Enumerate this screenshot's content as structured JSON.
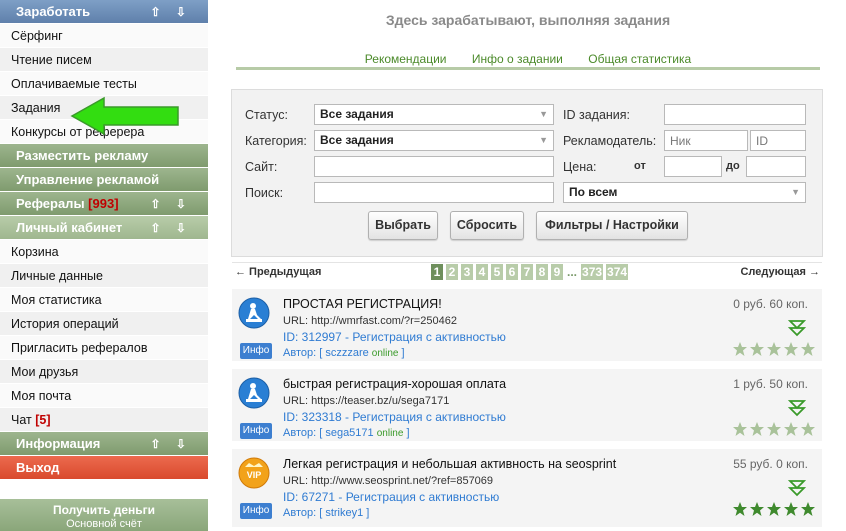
{
  "sidebar": {
    "earn": {
      "title": "Заработать",
      "arrows": "⇧ ⇩"
    },
    "earn_items": [
      "Сёрфинг",
      "Чтение писем",
      "Оплачиваемые тесты",
      "Задания",
      "Конкурсы от реферера"
    ],
    "place_ad": "Разместить рекламу",
    "manage_ad": "Управление рекламой",
    "referrals": {
      "title": "Рефералы",
      "count": "[993]",
      "arrows": "⇧ ⇩"
    },
    "cabinet": {
      "title": "Личный кабинет",
      "arrows": "⇧ ⇩"
    },
    "cabinet_items": [
      "Корзина",
      "Личные данные",
      "Моя статистика",
      "История операций",
      "Пригласить рефералов",
      "Мои друзья",
      "Моя почта"
    ],
    "chat": {
      "label": "Чат",
      "count": "[5]"
    },
    "information": {
      "title": "Информация",
      "arrows": "⇧ ⇩"
    },
    "logout": "Выход",
    "get_money": {
      "title": "Получить деньги",
      "subtitle": "Основной счёт"
    }
  },
  "main": {
    "heading": "Здесь зарабатывают, выполняя задания",
    "tabs": [
      "Рекомендации",
      "Инфо о задании",
      "Общая статистика"
    ]
  },
  "filter": {
    "status_label": "Статус:",
    "status_value": "Все задания",
    "category_label": "Категория:",
    "category_value": "Все задания",
    "site_label": "Сайт:",
    "search_label": "Поиск:",
    "task_id_label": "ID задания:",
    "advertiser_label": "Рекламодатель:",
    "nick_placeholder": "Ник",
    "id_placeholder": "ID",
    "price_label": "Цена:",
    "from_label": "от",
    "to_label": "до",
    "search_scope": "По всем",
    "btn_select": "Выбрать",
    "btn_reset": "Сбросить",
    "btn_filters": "Фильтры / Настройки"
  },
  "pager": {
    "prev": "← Предыдущая",
    "next": "Следующая →",
    "pages": [
      "1",
      "2",
      "3",
      "4",
      "5",
      "6",
      "7",
      "8",
      "9",
      "...",
      "373",
      "374"
    ],
    "current": "1"
  },
  "tasks": [
    {
      "title": "ПРОСТАЯ РЕГИСТРАЦИЯ!",
      "url": "URL: http://wmrfast.com/?r=250462",
      "id": "ID: 312997 - Регистрация с активностью",
      "author_prefix": "Автор: [ ",
      "author_nick": "sczzzare",
      "author_status": "online",
      "author_suffix": " ]",
      "price": "0 руб. 60 коп.",
      "info": "Инфо",
      "icon": "worker-icon",
      "rating": 0
    },
    {
      "title": "быстрая регистрация-хорошая оплата",
      "url": "URL: https://teaser.bz/u/sega7171",
      "id": "ID: 323318 - Регистрация с активностью",
      "author_prefix": "Автор: [ ",
      "author_nick": "sega5171",
      "author_status": "online",
      "author_suffix": " ]",
      "price": "1 руб. 50 коп.",
      "info": "Инфо",
      "icon": "worker-icon",
      "rating": 0
    },
    {
      "title": "Легкая регистрация и небольшая активность на seosprint",
      "url": "URL: http://www.seosprint.net/?ref=857069",
      "id": "ID: 67271 - Регистрация с активностью",
      "author_prefix": "Автор: [ ",
      "author_nick": "strikey1",
      "author_status": "",
      "author_suffix": " ]",
      "price": "55 руб. 0 коп.",
      "info": "Инфо",
      "icon": "vip-icon",
      "icon_text": "VIP",
      "rating": 5
    }
  ],
  "colors": {
    "menu_green": "#7f9b6e",
    "menu_blue": "#5f80ab",
    "logout_red": "#d94a2d",
    "link_blue": "#2f7bd2",
    "tab_green": "#4b8a2a",
    "arrow_green": "#33dd11"
  }
}
